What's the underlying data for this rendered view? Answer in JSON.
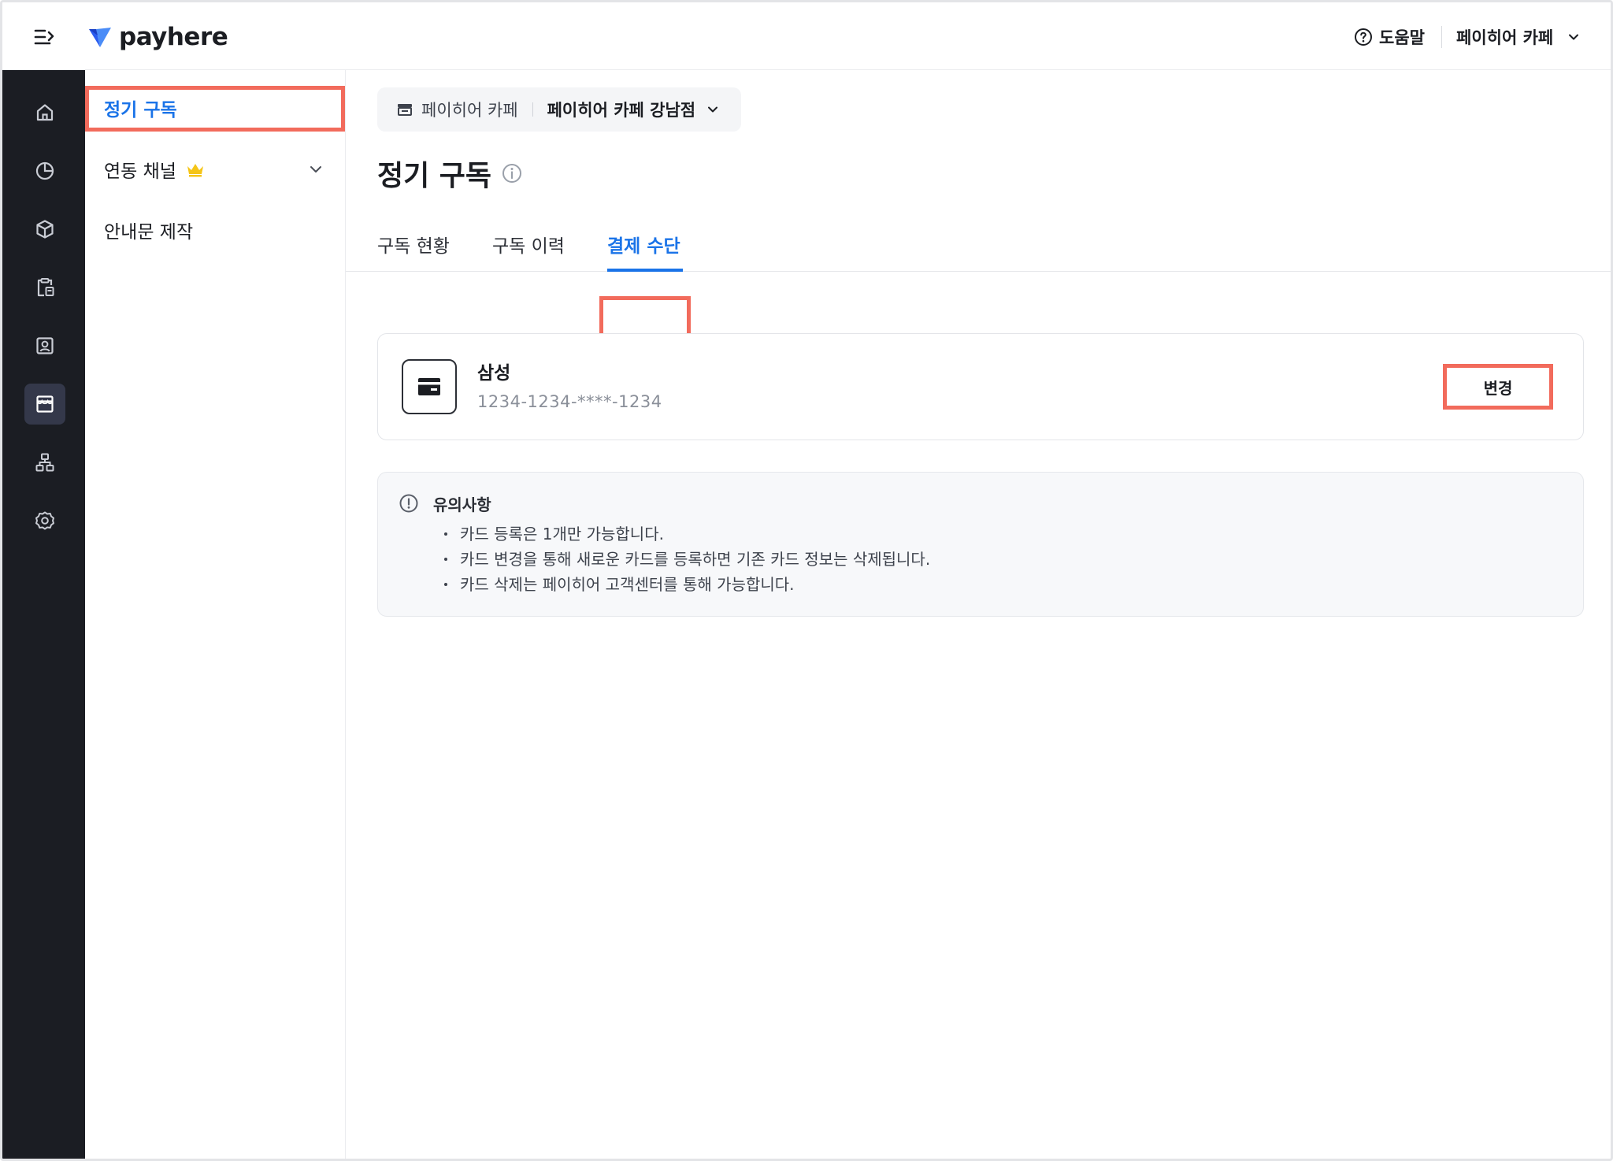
{
  "header": {
    "logo_text": "payhere",
    "help_label": "도움말",
    "store_menu_label": "페이히어 카페"
  },
  "subnav": {
    "items": [
      {
        "label": "정기 구독"
      },
      {
        "label": "연동 채널"
      },
      {
        "label": "안내문 제작"
      }
    ]
  },
  "store_selector": {
    "brand": "페이히어 카페",
    "branch": "페이히어 카페 강남점"
  },
  "page": {
    "title": "정기 구독"
  },
  "tabs": [
    {
      "label": "구독 현황"
    },
    {
      "label": "구독 이력"
    },
    {
      "label": "결제 수단"
    }
  ],
  "payment_card": {
    "issuer": "삼성",
    "number": "1234-1234-****-1234",
    "change_label": "변경"
  },
  "notice": {
    "title": "유의사항",
    "items": [
      "카드 등록은 1개만 가능합니다.",
      "카드 변경을 통해 새로운 카드를 등록하면 기존 카드 정보는 삭제됩니다.",
      "카드 삭제는 페이히어 고객센터를 통해 가능합니다."
    ]
  },
  "colors": {
    "accent": "#1a73e8",
    "highlight": "#f26b5c",
    "rail": "#1b1d23",
    "crown": "#f5c518"
  }
}
